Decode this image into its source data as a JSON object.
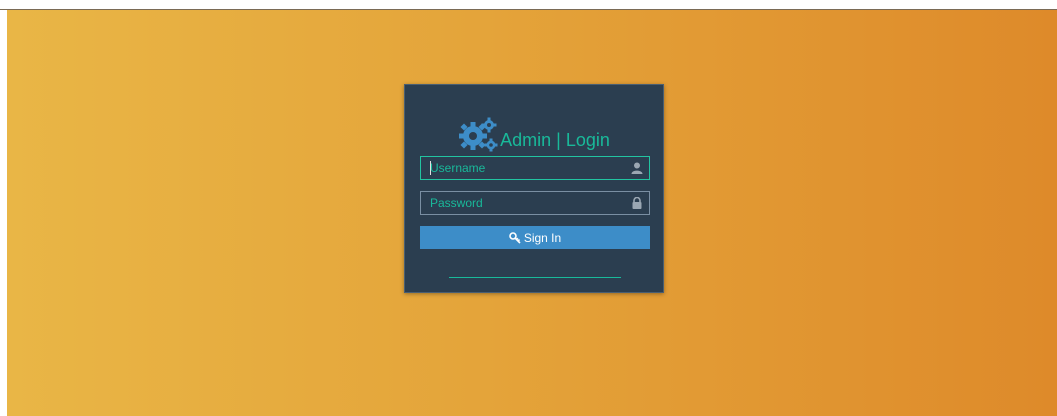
{
  "login": {
    "title": "Admin | Login",
    "username": {
      "placeholder": "Username",
      "value": "",
      "icon": "user-icon"
    },
    "password": {
      "placeholder": "Password",
      "value": "",
      "icon": "lock-icon"
    },
    "submit": {
      "label": "Sign In",
      "icon": "key-icon"
    },
    "brand_icon": "gears-icon"
  },
  "colors": {
    "background_start": "#e9b646",
    "background_end": "#de8a2a",
    "card": "#2b3e50",
    "accent": "#19b99a",
    "button": "#3d8dc8",
    "gears": "#3d8dc8"
  }
}
